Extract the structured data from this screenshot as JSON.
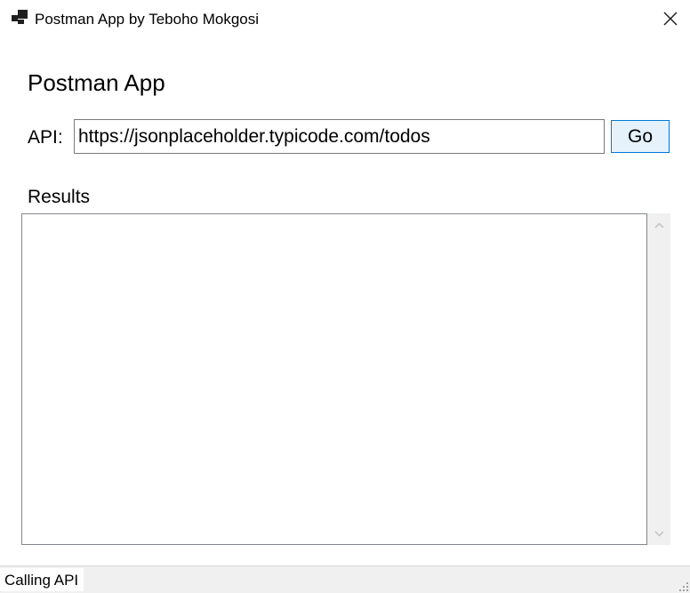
{
  "window": {
    "title": "Postman App by Teboho Mokgosi",
    "app_icon": "app-window-icon",
    "close_icon": "close-icon"
  },
  "main": {
    "heading": "Postman App",
    "api_label": "API:",
    "api_url": "https://jsonplaceholder.typicode.com/todos",
    "go_label": "Go",
    "results_label": "Results",
    "results_text": ""
  },
  "status": {
    "text": "Calling API"
  },
  "colors": {
    "go_button_border": "#0078d7",
    "go_button_fill": "#e5f1fb",
    "status_bar": "#f0f0f0",
    "scrollbar_track": "#f0f0f0"
  }
}
